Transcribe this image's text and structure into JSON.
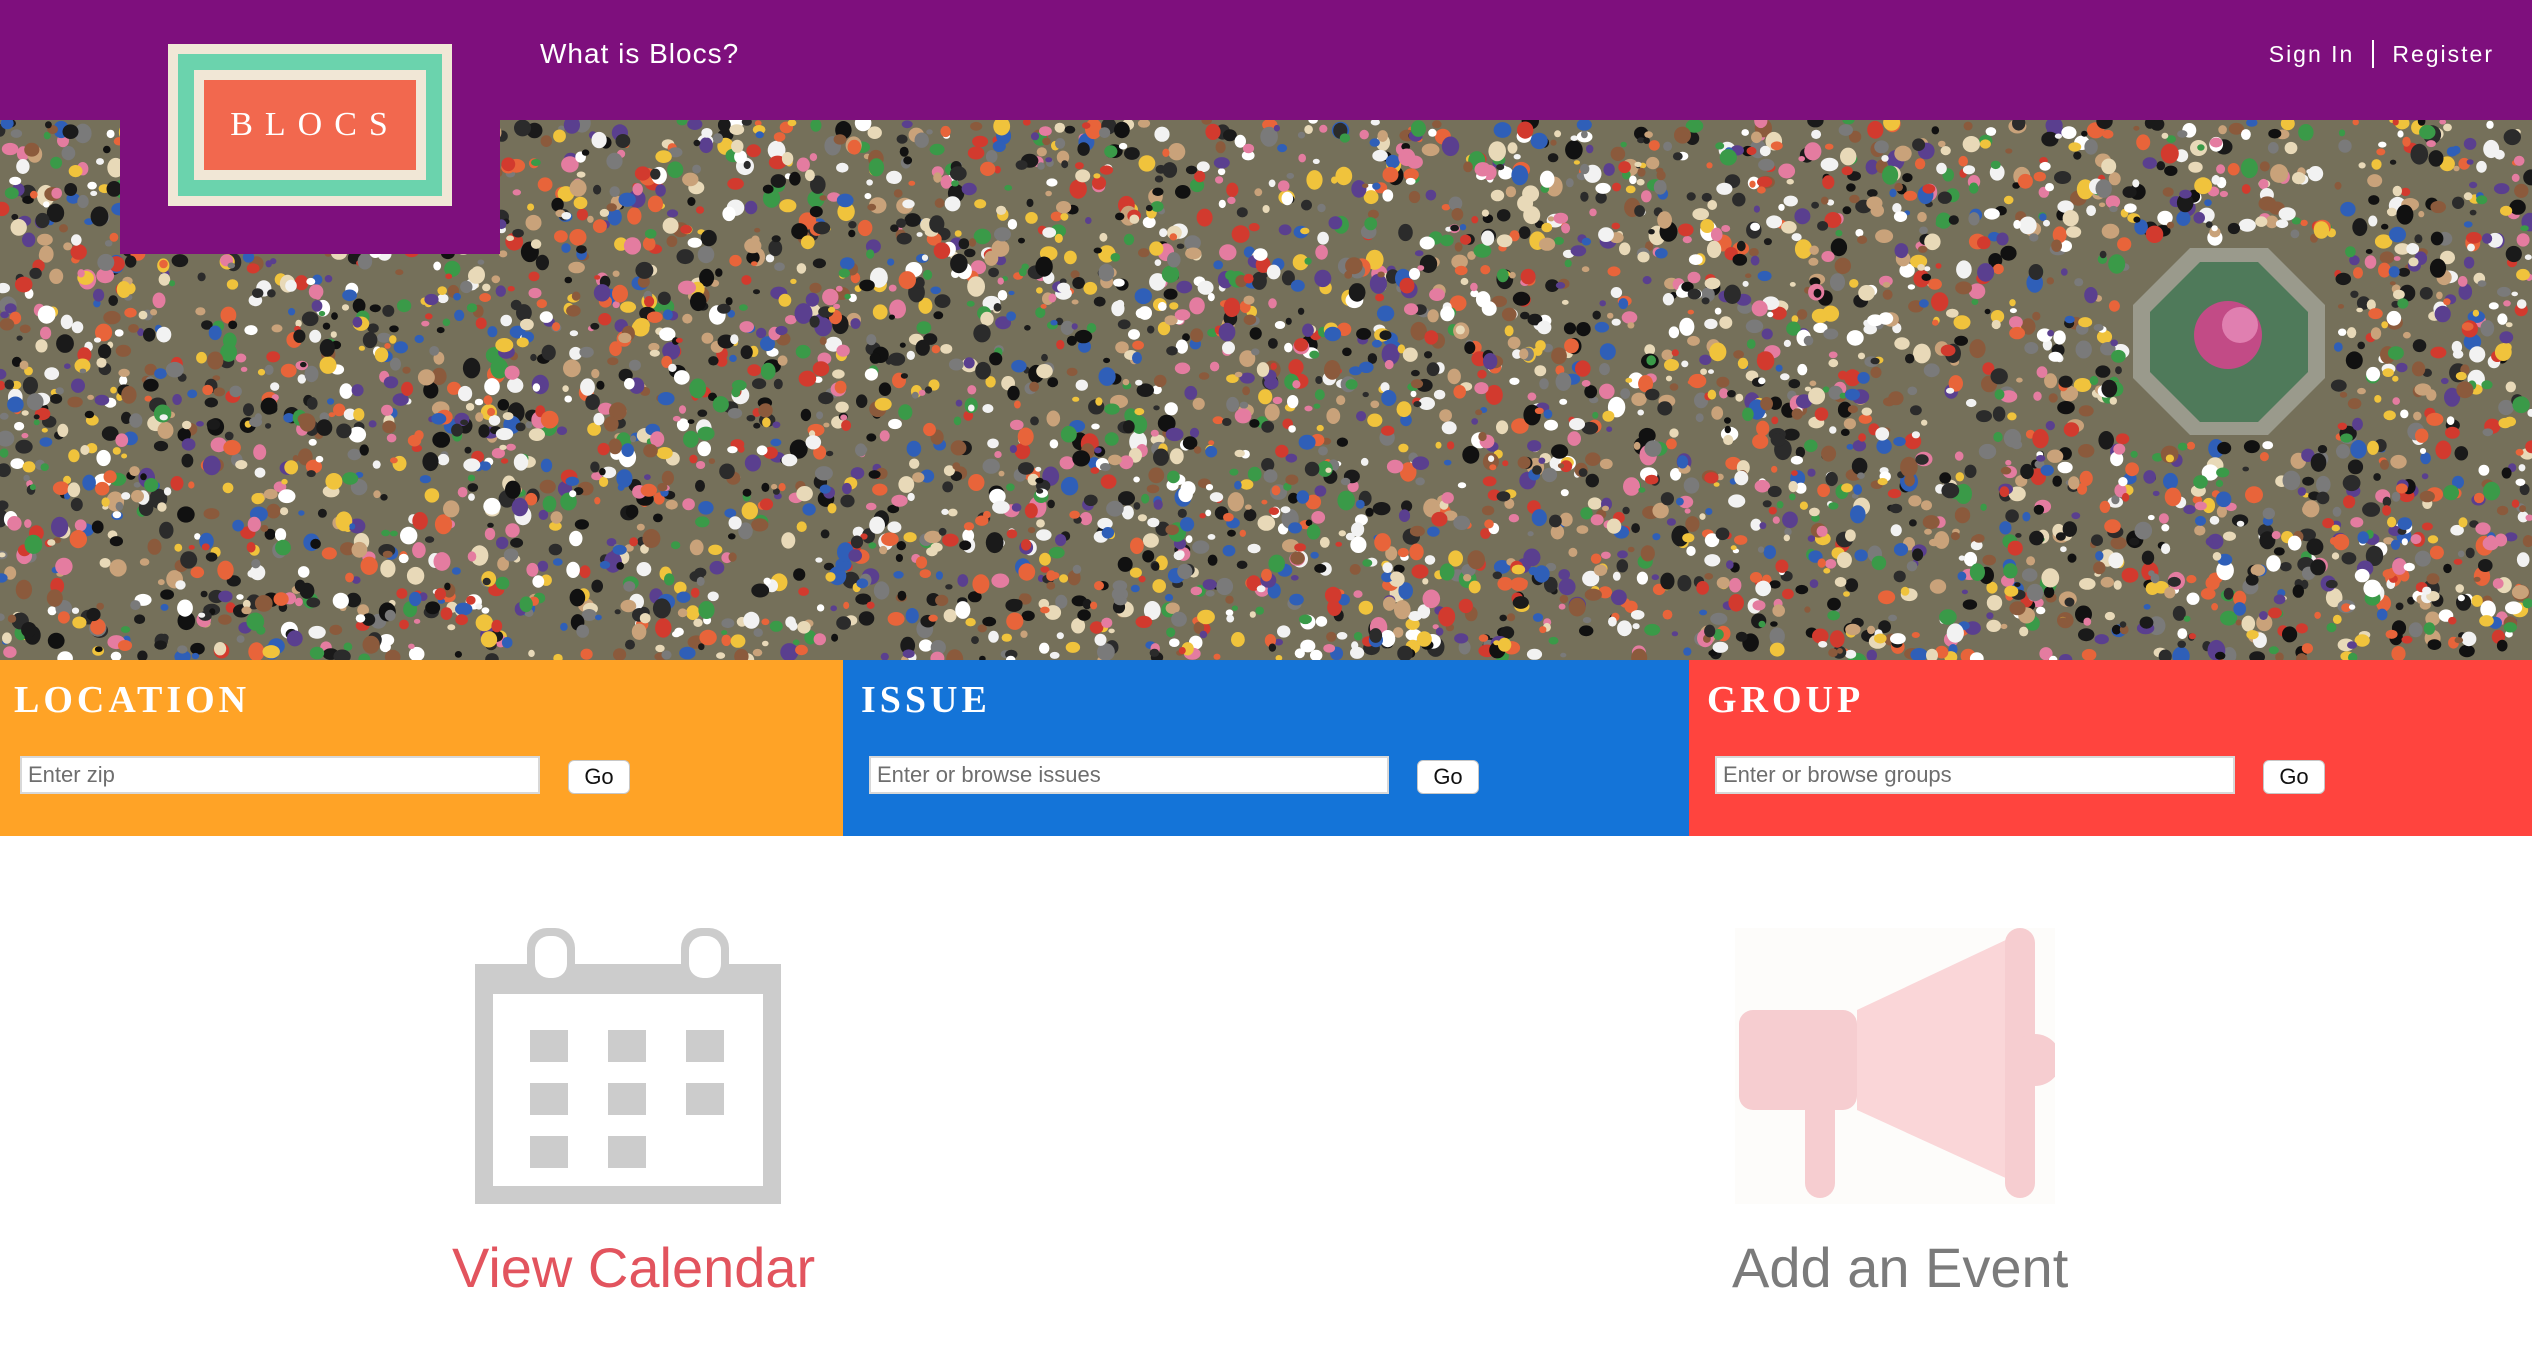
{
  "header": {
    "logo_text": "BLOCS",
    "what_link": "What is Blocs?",
    "sign_in": "Sign In",
    "register": "Register"
  },
  "hero": {
    "image_subject": "crowd"
  },
  "search": {
    "location": {
      "title": "LOCATION",
      "placeholder": "Enter zip",
      "button": "Go",
      "color": "#ffa326"
    },
    "issue": {
      "title": "ISSUE",
      "placeholder": "Enter or browse issues",
      "button": "Go",
      "color": "#1474d8"
    },
    "group": {
      "title": "GROUP",
      "placeholder": "Enter or browse groups",
      "button": "Go",
      "color": "#ff443e"
    }
  },
  "actions": {
    "calendar": {
      "label": "View Calendar",
      "icon": "calendar-icon",
      "color": "#e2545e"
    },
    "event": {
      "label": "Add an Event",
      "icon": "megaphone-icon",
      "color": "#7b7b7b"
    }
  },
  "colors": {
    "header_bg": "#7e0f7d",
    "logo_green": "#6bd3ad",
    "logo_red": "#f2684e"
  }
}
